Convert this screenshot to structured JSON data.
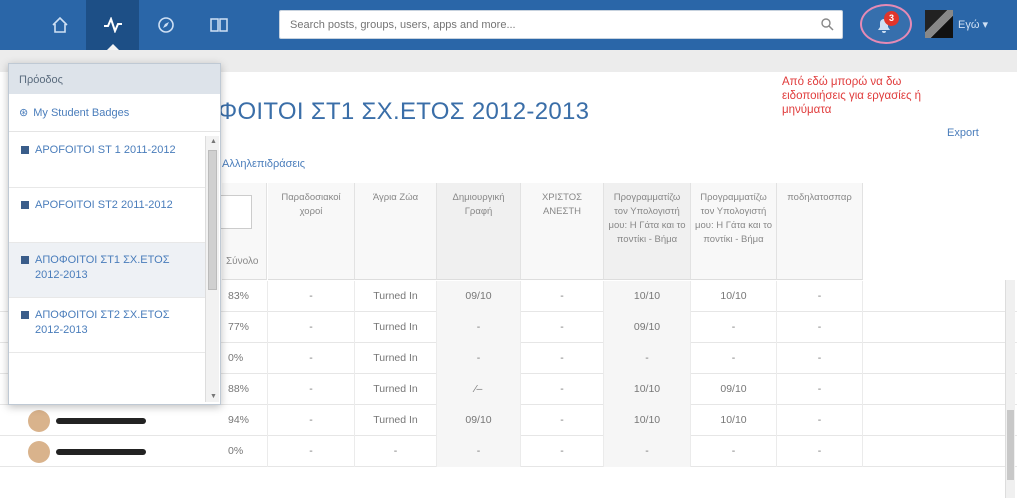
{
  "topbar": {
    "search_placeholder": "Search posts, groups, users, apps and more...",
    "notification_count": "3",
    "user_label": "Εγώ ▾"
  },
  "annotation": "Από εδώ μπορώ να δω ειδοποιήσεις για εργασίες ή μηνύματα",
  "export_label": "Export",
  "page_title": "ΦΟΙΤΟΙ ΣΤ1 ΣΧ.ΕΤΟΣ 2012-2013",
  "sublink": "Αλληλεπιδράσεις",
  "total_label": "Σύνολο",
  "dropdown": {
    "header": "Πρόοδος",
    "badges_label": "My Student Badges",
    "items": [
      {
        "label": "APOFOITOI ST 1 2011-2012"
      },
      {
        "label": "APOFOITOI ST2 2011-2012"
      },
      {
        "label": "ΑΠΟΦΟΙΤΟΙ ΣΤ1 ΣΧ.ΕΤΟΣ 2012-2013"
      },
      {
        "label": "ΑΠΟΦΟΙΤΟΙ ΣΤ2 ΣΧ.ΕΤΟΣ 2012-2013"
      }
    ]
  },
  "columns": [
    "Παραδοσιακοί χοροί",
    "Άγρια Ζώα",
    "Δημιουργική Γραφή",
    "ΧΡΙΣΤΟΣ ΑΝΕΣΤΗ",
    "Προγραμματίζω τον Υπολογιστή μου: Η Γάτα και το ποντίκι - Βήμα",
    "Προγραμματίζω τον Υπολογιστή μου: Η Γάτα και το ποντίκι - Βήμα",
    "ποδηλατοσπαρ"
  ],
  "rows": [
    {
      "total": "83%",
      "cells": [
        "-",
        "Turned In",
        "09/10",
        "-",
        "10/10",
        "10/10",
        "-"
      ]
    },
    {
      "total": "77%",
      "cells": [
        "-",
        "Turned In",
        "-",
        "-",
        "09/10",
        "-",
        "-"
      ]
    },
    {
      "total": "0%",
      "cells": [
        "-",
        "Turned In",
        "-",
        "-",
        "-",
        "-",
        "-"
      ]
    },
    {
      "total": "88%",
      "cells": [
        "-",
        "Turned In",
        "⁄–",
        "-",
        "10/10",
        "09/10",
        "-"
      ]
    },
    {
      "total": "94%",
      "cells": [
        "-",
        "Turned In",
        "09/10",
        "-",
        "10/10",
        "10/10",
        "-"
      ]
    },
    {
      "total": "0%",
      "cells": [
        "-",
        "-",
        "-",
        "-",
        "-",
        "-",
        "-"
      ]
    }
  ]
}
